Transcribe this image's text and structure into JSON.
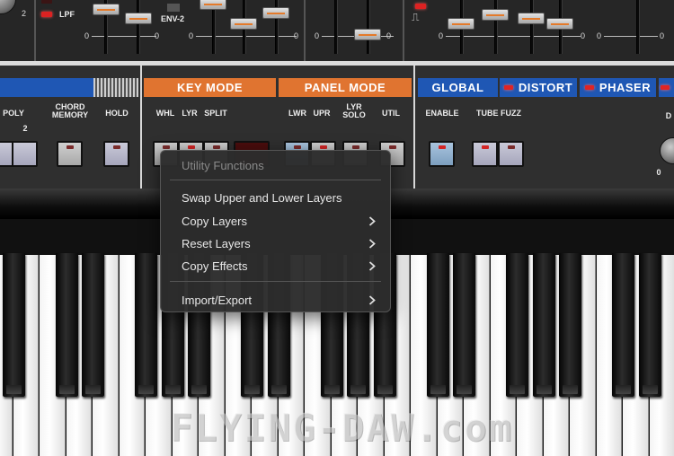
{
  "top_section": {
    "lpf_label": "LPF",
    "env_label": "ENV-2",
    "knob_value": "2",
    "zero_label": "0"
  },
  "panel": {
    "key_mode_title": "KEY MODE",
    "panel_mode_title": "PANEL MODE",
    "global_title": "GLOBAL",
    "distort_title": "DISTORT",
    "phaser_title": "PHASER",
    "labels": {
      "poly": "POLY",
      "poly_value": "2",
      "chord_memory": "CHORD\nMEMORY",
      "hold": "HOLD",
      "whl": "WHL",
      "lyr": "LYR",
      "split": "SPLIT",
      "lwr": "LWR",
      "upr": "UPR",
      "lyr_solo": "LYR\nSOLO",
      "util": "UTIL",
      "enable": "ENABLE",
      "tube_fuzz": "TUBE FUZZ",
      "d_cut": "D",
      "zero": "0"
    }
  },
  "context_menu": {
    "title": "Utility Functions",
    "items": [
      {
        "label": "Swap Upper and Lower Layers",
        "has_submenu": false
      },
      {
        "label": "Copy Layers",
        "has_submenu": true
      },
      {
        "label": "Reset Layers",
        "has_submenu": true
      },
      {
        "label": "Copy Effects",
        "has_submenu": true
      },
      {
        "label": "Import/Export",
        "has_submenu": true
      }
    ]
  },
  "watermark": "FLYING-DAW.com",
  "colors": {
    "orange_header": "#e07430",
    "blue_header": "#1f57b4",
    "led_red": "#d22222",
    "menu_bg": "#2c2c2c"
  }
}
